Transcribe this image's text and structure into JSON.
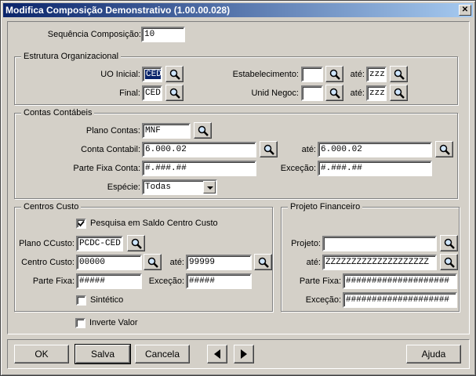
{
  "window": {
    "title": "Modifica Composição Demonstrativo (1.00.00.028)",
    "close_glyph": "✕"
  },
  "sequencia": {
    "label": "Sequência Composição:",
    "value": "10"
  },
  "estrutura": {
    "title": "Estrutura Organizacional",
    "uo_inicial_label": "UO Inicial:",
    "uo_inicial_value": "CED",
    "final_label": "Final:",
    "final_value": "CED",
    "estabelecimento_label": "Estabelecimento:",
    "estabelecimento_value": "",
    "unid_negoc_label": "Unid Negoc:",
    "unid_negoc_value": "",
    "ate_label": "até:",
    "estab_ate_value": "zzz",
    "unid_ate_value": "zzz"
  },
  "contas": {
    "title": "Contas Contábeis",
    "plano_label": "Plano Contas:",
    "plano_value": "MNF",
    "conta_label": "Conta Contabil:",
    "conta_value": "6.000.02",
    "ate_label": "até:",
    "conta_ate_value": "6.000.02",
    "parte_fixa_label": "Parte Fixa Conta:",
    "parte_fixa_value": "#.###.##",
    "excecao_label": "Exceção:",
    "excecao_value": "#.###.##",
    "especie_label": "Espécie:",
    "especie_value": "Todas"
  },
  "centros": {
    "title": "Centros Custo",
    "pesquisa_label": "Pesquisa em Saldo Centro Custo",
    "pesquisa_checked": true,
    "plano_label": "Plano CCusto:",
    "plano_value": "PCDC-CED",
    "centro_label": "Centro Custo:",
    "centro_value": "00000",
    "ate_label": "até:",
    "centro_ate_value": "99999",
    "parte_fixa_label": "Parte Fixa:",
    "parte_fixa_value": "#####",
    "excecao_label": "Exceção:",
    "excecao_value": "#####",
    "sintetico_label": "Sintético",
    "sintetico_checked": false
  },
  "projeto": {
    "title": "Projeto Financeiro",
    "projeto_label": "Projeto:",
    "projeto_value": "",
    "ate_label": "até:",
    "ate_value": "ZZZZZZZZZZZZZZZZZZZZ",
    "parte_fixa_label": "Parte Fixa:",
    "parte_fixa_value": "####################",
    "excecao_label": "Exceção:",
    "excecao_value": "####################"
  },
  "inverte": {
    "label": "Inverte Valor",
    "checked": false
  },
  "buttons": {
    "ok": "OK",
    "salva": "Salva",
    "cancela": "Cancela",
    "ajuda": "Ajuda"
  }
}
